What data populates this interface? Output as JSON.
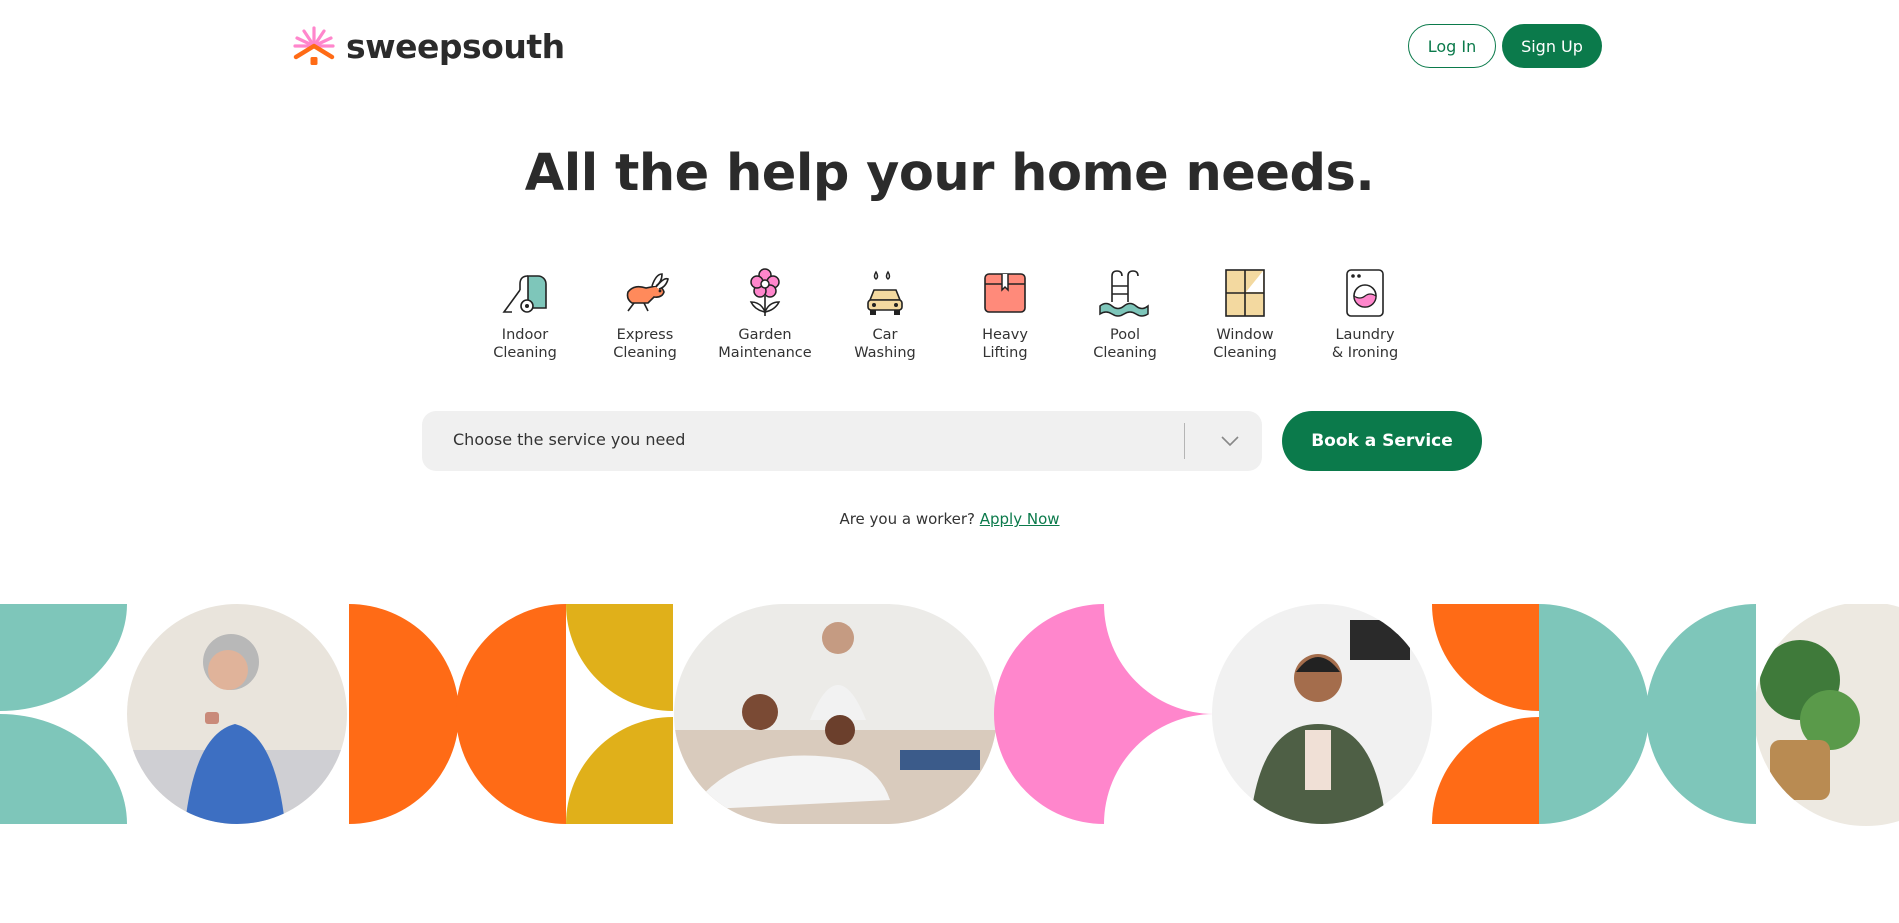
{
  "header": {
    "brand": "sweepsouth",
    "login_label": "Log In",
    "signup_label": "Sign Up"
  },
  "hero": {
    "title": "All the help your home needs."
  },
  "services": [
    {
      "label": "Indoor\nCleaning",
      "icon": "vacuum-icon"
    },
    {
      "label": "Express\nCleaning",
      "icon": "rabbit-icon"
    },
    {
      "label": "Garden\nMaintenance",
      "icon": "flower-icon"
    },
    {
      "label": "Car\nWashing",
      "icon": "car-icon"
    },
    {
      "label": "Heavy\nLifting",
      "icon": "box-icon"
    },
    {
      "label": "Pool\nCleaning",
      "icon": "pool-icon"
    },
    {
      "label": "Window\nCleaning",
      "icon": "window-icon"
    },
    {
      "label": "Laundry\n& Ironing",
      "icon": "washing-machine-icon"
    }
  ],
  "search": {
    "placeholder": "Choose the service you need",
    "book_label": "Book a Service"
  },
  "worker": {
    "prompt": "Are you a worker?",
    "link": "Apply Now"
  },
  "colors": {
    "brand_green": "#0b7a4b",
    "teal": "#7ec6ba",
    "orange": "#ff6b16",
    "mustard": "#e0b01a",
    "pink": "#ff86cc"
  }
}
